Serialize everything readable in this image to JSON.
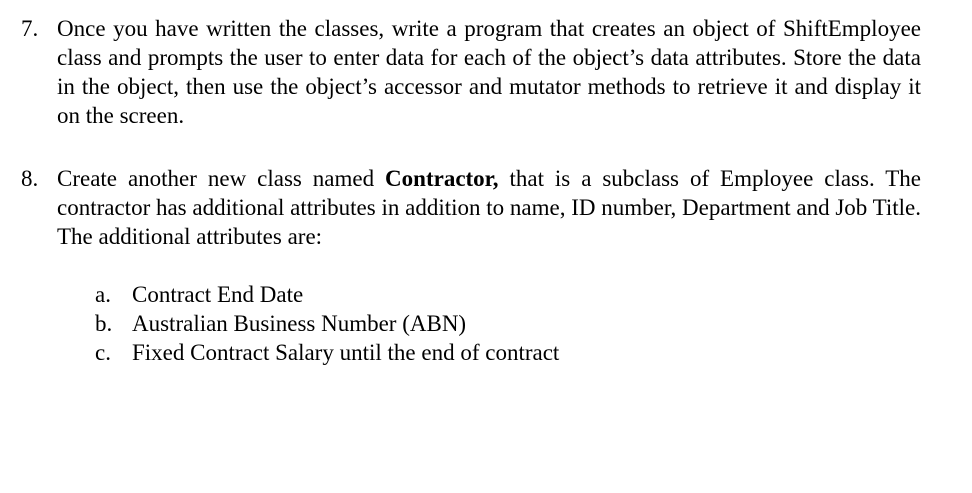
{
  "items": [
    {
      "number": "7.",
      "text": "Once you have written the classes, write a program that creates an object of ShiftEmployee class and prompts the user to enter data for each of the object’s data attributes. Store the data in the object, then use the object’s accessor and mutator methods to retrieve it and display it on the screen."
    },
    {
      "number": "8.",
      "text_before": "Create another new class named ",
      "text_bold": "Contractor,",
      "text_after": " that is a subclass of Employee class. The contractor has additional attributes in addition to name, ID number, Department and Job Title. The additional attributes are:"
    }
  ],
  "sub_items": [
    {
      "letter": "a.",
      "text": "Contract End Date"
    },
    {
      "letter": "b.",
      "text": "Australian Business Number (ABN)"
    },
    {
      "letter": "c.",
      "text": "Fixed Contract Salary until the end of contract"
    }
  ]
}
